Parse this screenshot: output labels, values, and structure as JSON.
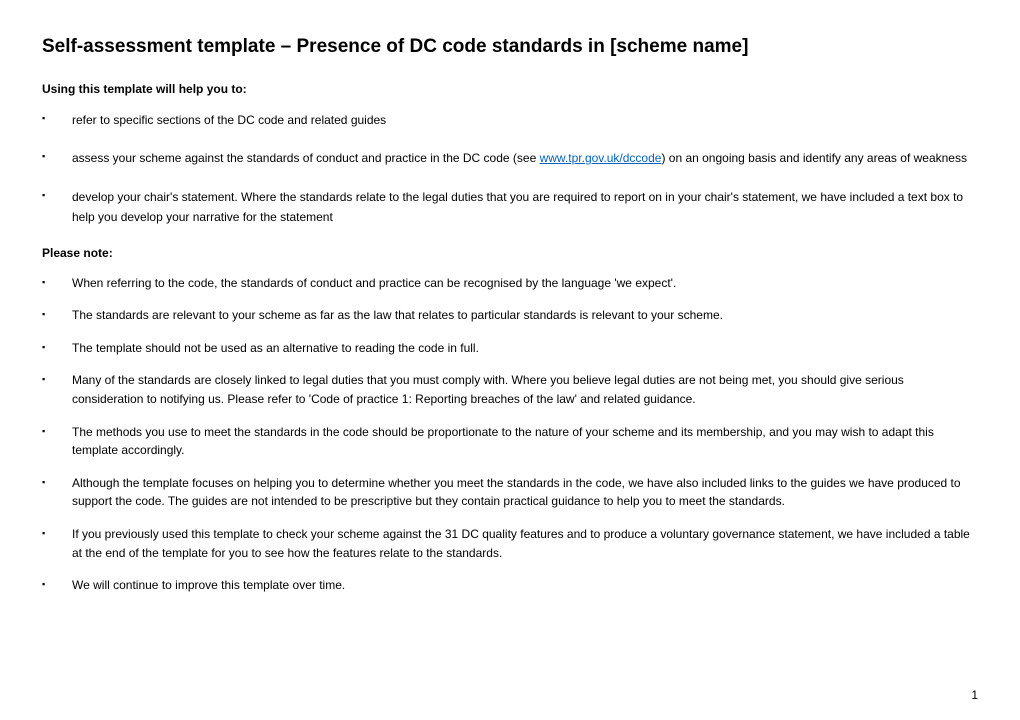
{
  "title": "Self-assessment template – Presence of DC code standards in [scheme name]",
  "section1": {
    "label": "Using this template will help you to:",
    "items": [
      {
        "text": "refer to specific sections of the DC code and related guides"
      },
      {
        "text_before": "assess your scheme against the standards of conduct and practice in the DC code (see ",
        "link_text": "www.tpr.gov.uk/dccode",
        "text_after": ") on an ongoing basis and identify any areas of weakness"
      },
      {
        "text": "develop your chair's statement. Where the standards relate to the legal duties that you are required to report on in your chair's statement, we have included a text box to help you develop your narrative for the statement"
      }
    ]
  },
  "section2": {
    "label": "Please note:",
    "items": [
      {
        "text": "When referring to the code, the standards of conduct and practice can be recognised by the language 'we expect'."
      },
      {
        "text": "The standards are relevant to your scheme as far as the law that relates to particular standards is relevant to your scheme."
      },
      {
        "text": "The template should not be used as an alternative to reading the code in full."
      },
      {
        "text": "Many of the standards are closely linked to legal duties that you must comply with. Where you believe legal duties are not being met, you should give serious consideration to notifying us. Please refer to 'Code of practice 1: Reporting breaches of the law' and related guidance."
      },
      {
        "text": "The methods you use to meet the standards in the code should be proportionate to the nature of your scheme and its membership, and you may wish to adapt this template accordingly."
      },
      {
        "text": "Although the template focuses on helping you to determine whether you meet the standards in the code, we have also included links to the guides we have produced to support the code. The guides are not intended to be prescriptive but they contain practical guidance to help you to meet the standards."
      },
      {
        "text": "If you previously used this template to check your scheme against the 31 DC quality features and to produce a voluntary governance statement, we have included a table at the end of the template for you to see how the features relate to the standards."
      },
      {
        "text": "We will continue to improve this template over time."
      }
    ]
  },
  "page_number": "1"
}
